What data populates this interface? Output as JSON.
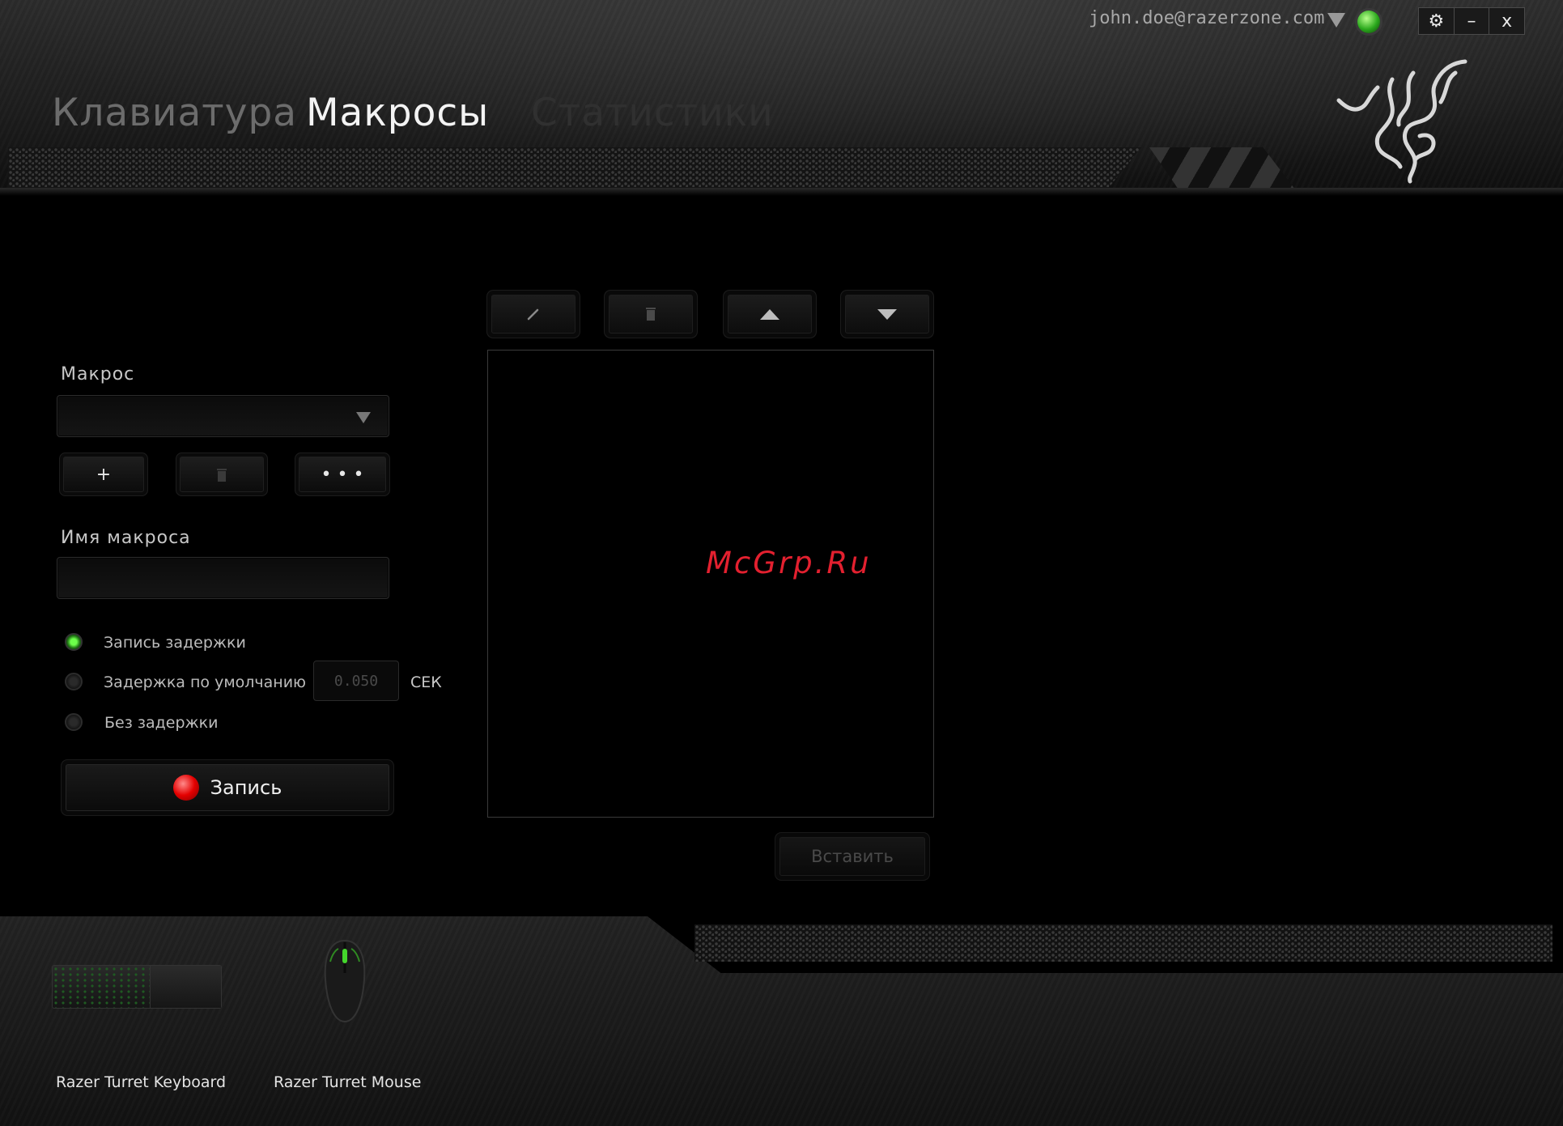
{
  "account": {
    "email": "john.doe@razerzone.com"
  },
  "window_controls": {
    "settings": "⚙",
    "minimize": "–",
    "close": "x"
  },
  "tabs": [
    {
      "label": "Клавиатура",
      "state": "inactive"
    },
    {
      "label": "Макросы",
      "state": "active"
    },
    {
      "label": "Статистики",
      "state": "disabled"
    }
  ],
  "macro_panel": {
    "macro_label": "Макрос",
    "macro_select_value": "",
    "add_label": "+",
    "delete_icon": "trash-icon",
    "more_label": "• • •",
    "name_label": "Имя макроса",
    "name_value": "",
    "delay_options": [
      {
        "label": "Запись задержки",
        "selected": true
      },
      {
        "label": "Задержка по умолчанию",
        "selected": false
      },
      {
        "label": "Без задержки",
        "selected": false
      }
    ],
    "default_delay_value": "0.050",
    "delay_unit": "СЕК",
    "record_label": "Запись"
  },
  "editor": {
    "toolbar": [
      "edit-icon",
      "trash-icon",
      "move-up-icon",
      "move-down-icon"
    ],
    "insert_label": "Вставить"
  },
  "watermark": "McGrp.Ru",
  "devices": [
    {
      "name": "Razer Turret Keyboard"
    },
    {
      "name": "Razer Turret Mouse"
    }
  ],
  "colors": {
    "accent_green": "#44d62c",
    "record_red": "#e40000",
    "watermark_red": "#e3202f"
  }
}
